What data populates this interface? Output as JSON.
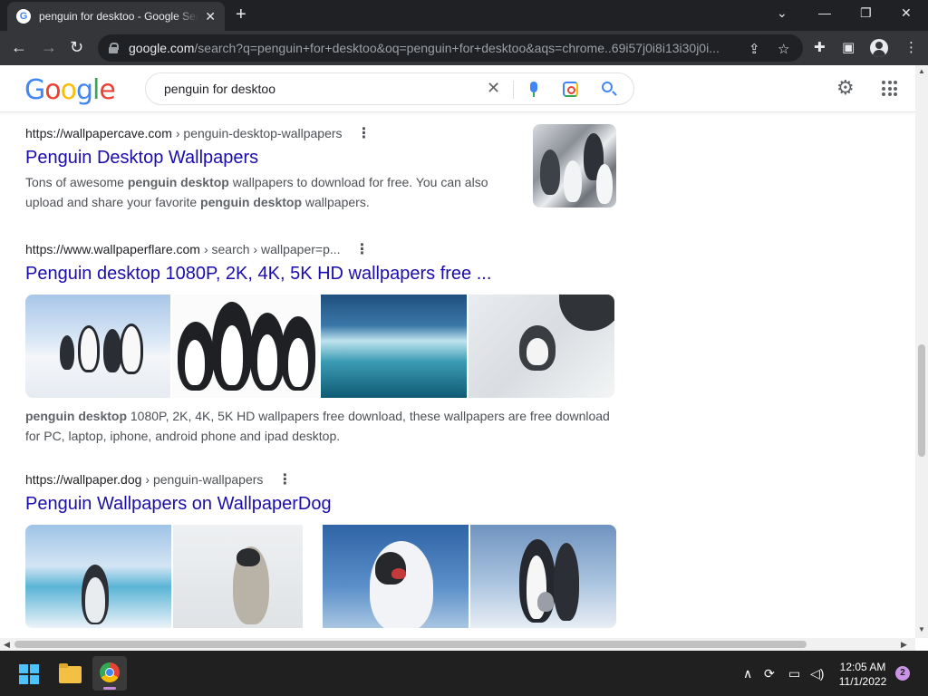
{
  "browser": {
    "tab_title": "penguin for desktoo - Google Search",
    "tab_favicon": "G",
    "new_tab_label": "+",
    "url_domain": "google.com",
    "url_path": "/search?q=penguin+for+desktoo&oq=penguin+for+desktoo&aqs=chrome..69i57j0i8i13i30j0i...",
    "icons": [
      "back-arrow-icon",
      "forward-arrow-icon",
      "reload-icon",
      "lock-icon",
      "share-icon",
      "star-icon",
      "extensions-icon",
      "side-panel-icon",
      "profile-icon",
      "menu-icon"
    ]
  },
  "search": {
    "query": "penguin for desktoo",
    "logo": [
      "G",
      "o",
      "o",
      "g",
      "l",
      "e"
    ]
  },
  "results": [
    {
      "site": "https://wallpapercave.com",
      "path": "› penguin-desktop-wallpapers",
      "title": "Penguin Desktop Wallpapers",
      "snippet_parts": [
        "Tons of awesome ",
        "penguin desktop",
        " wallpapers to download for free. You can also upload and share your favorite ",
        "penguin desktop",
        " wallpapers."
      ]
    },
    {
      "site": "https://www.wallpaperflare.com",
      "path": "› search › wallpaper=p...",
      "title": "Penguin desktop 1080P, 2K, 4K, 5K HD wallpapers free ...",
      "snippet_parts": [
        "penguin desktop",
        " 1080P, 2K, 4K, 5K HD wallpapers free download, these wallpapers are free download for PC, laptop, iphone, android phone and ipad desktop."
      ]
    },
    {
      "site": "https://wallpaper.dog",
      "path": "› penguin-wallpapers",
      "title": "Penguin Wallpapers on WallpaperDog"
    }
  ],
  "taskbar": {
    "time": "12:05 AM",
    "date": "11/1/2022",
    "notification_count": "2",
    "accent_color": "#c994e6"
  },
  "colors": {
    "link": "#1a0dab",
    "chrome_dark": "#202124",
    "chrome_toolbar": "#35363a"
  }
}
